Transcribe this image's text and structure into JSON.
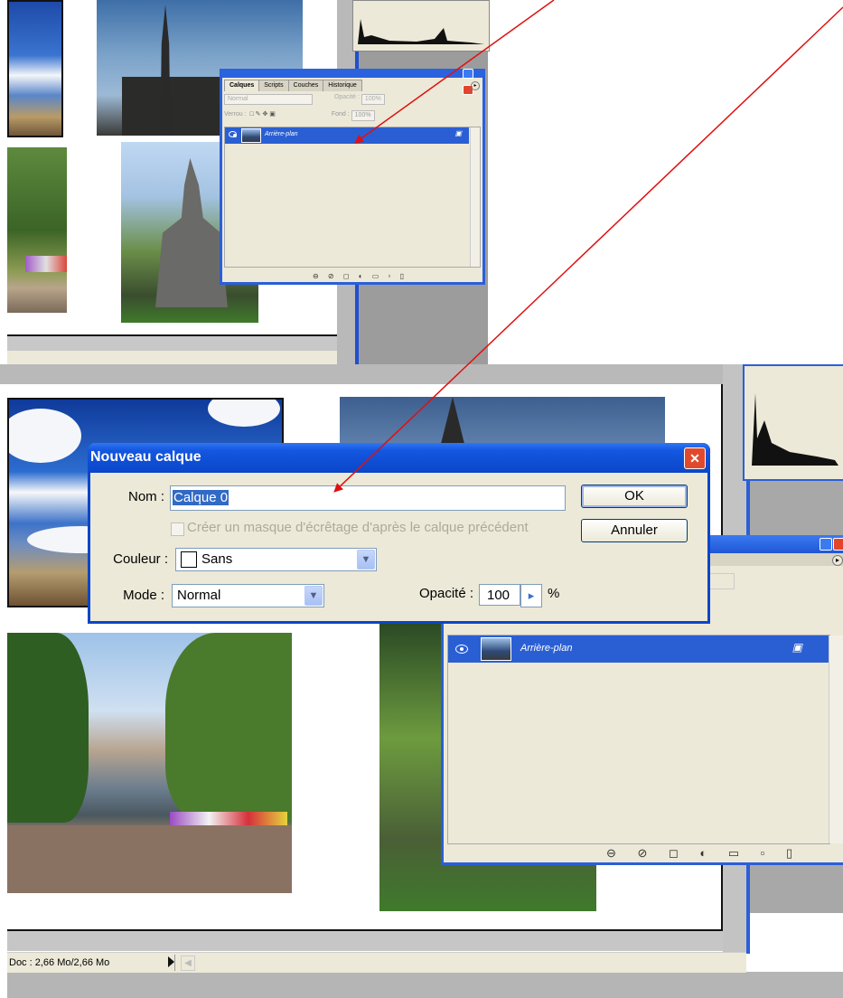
{
  "top_palette": {
    "tabs": [
      "Calques",
      "Scripts",
      "Couches",
      "Historique"
    ],
    "blend_mode": "Normal",
    "opacity_label": "Opacité :",
    "opacity_value": "100%",
    "lock_label": "Verrou :",
    "fill_label": "Fond :",
    "fill_value": "100%",
    "layer_name": "Arrière-plan"
  },
  "dialog": {
    "title": "Nouveau calque",
    "name_label": "Nom :",
    "name_value": "Calque 0",
    "ok_label": "OK",
    "cancel_label": "Annuler",
    "clipping_mask_label": "Créer un masque d'écrêtage d'après le calque précédent",
    "color_label": "Couleur :",
    "color_value": "Sans",
    "mode_label": "Mode :",
    "mode_value": "Normal",
    "opacity_label": "Opacité :",
    "opacity_value": "100",
    "opacity_unit": "%"
  },
  "bottom_palette": {
    "layer_name": "Arrière-plan"
  },
  "status_bar": {
    "doc_info": "Doc : 2,66 Mo/2,66 Mo"
  },
  "colors": {
    "xp_blue": "#0a46c9",
    "selection_blue": "#2a5fd4",
    "dialog_bg": "#ece9d8",
    "arrow_red": "#e01010"
  },
  "icons": [
    "eye-icon",
    "lock-icon",
    "link-icon",
    "fx-icon",
    "mask-icon",
    "adjustment-icon",
    "folder-icon",
    "new-layer-icon",
    "trash-icon",
    "close-icon",
    "minimize-icon",
    "dropdown-icon",
    "checkbox-icon",
    "palette-menu-icon"
  ]
}
